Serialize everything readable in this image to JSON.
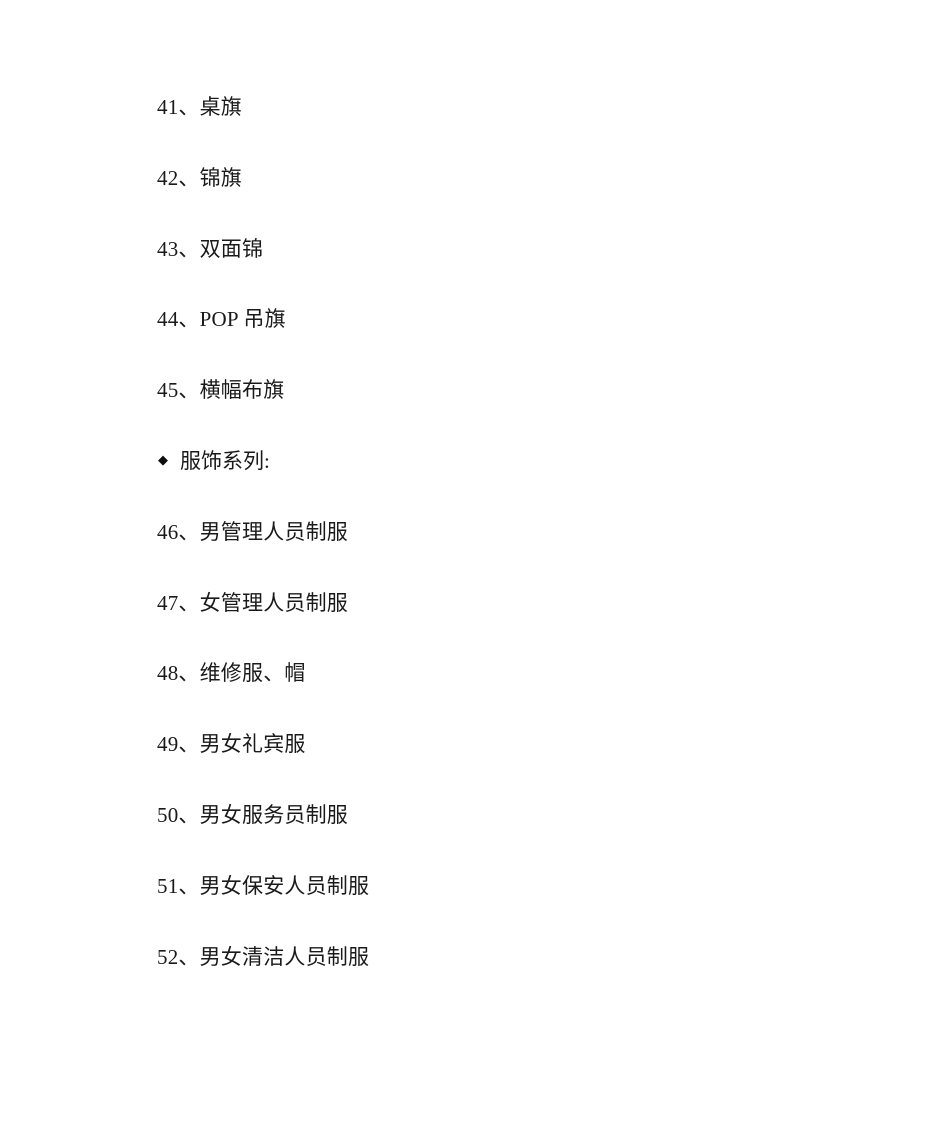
{
  "document": {
    "background_color": "#ffffff",
    "text_color": "#1a1a1a",
    "blocks": [
      {
        "kind": "numbered",
        "number": "41、",
        "text": "桌旗"
      },
      {
        "kind": "numbered",
        "number": "42、",
        "text": "锦旗"
      },
      {
        "kind": "numbered",
        "number": "43、",
        "text": "双面锦"
      },
      {
        "kind": "numbered",
        "number": "44、",
        "text": "POP 吊旗"
      },
      {
        "kind": "numbered",
        "number": "45、",
        "text": "横幅布旗"
      },
      {
        "kind": "bullet",
        "marker": "◆",
        "text": "服饰系列:"
      },
      {
        "kind": "numbered",
        "number": "46、",
        "text": "男管理人员制服"
      },
      {
        "kind": "numbered",
        "number": "47、",
        "text": "女管理人员制服"
      },
      {
        "kind": "numbered",
        "number": "48、",
        "text": "维修服、帽"
      },
      {
        "kind": "numbered",
        "number": "49、",
        "text": "男女礼宾服"
      },
      {
        "kind": "numbered",
        "number": "50、",
        "text": "男女服务员制服"
      },
      {
        "kind": "numbered",
        "number": "51、",
        "text": "男女保安人员制服"
      },
      {
        "kind": "numbered",
        "number": "52、",
        "text": "男女清洁人员制服"
      }
    ]
  }
}
